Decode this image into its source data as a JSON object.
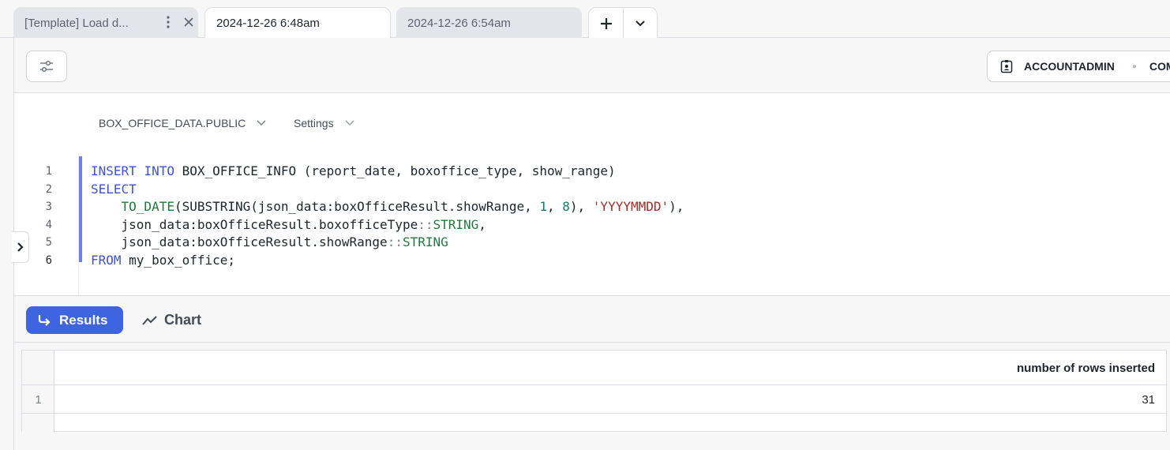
{
  "tabs": [
    {
      "label": "[Template] Load d...",
      "state": "inactive"
    },
    {
      "label": "2024-12-26 6:48am",
      "state": "active"
    },
    {
      "label": "2024-12-26 6:54am",
      "state": "inactive"
    }
  ],
  "toolbar": {
    "role": "ACCOUNTADMIN",
    "warehouse_partial": "COM"
  },
  "context": {
    "database": "BOX_OFFICE_DATA.PUBLIC",
    "settings": "Settings"
  },
  "editor": {
    "line_numbers": [
      "1",
      "2",
      "3",
      "4",
      "5",
      "6"
    ],
    "lines": [
      [
        {
          "t": "INSERT",
          "c": "kw"
        },
        {
          "t": " "
        },
        {
          "t": "INTO",
          "c": "kw"
        },
        {
          "t": " BOX_OFFICE_INFO (report_date, boxoffice_type, show_range)"
        }
      ],
      [
        {
          "t": "SELECT",
          "c": "kw"
        }
      ],
      [
        {
          "t": "    "
        },
        {
          "t": "TO_DATE",
          "c": "fn"
        },
        {
          "t": "(SUBSTRING(json_data:boxOfficeResult.showRange, "
        },
        {
          "t": "1",
          "c": "num"
        },
        {
          "t": ", "
        },
        {
          "t": "8",
          "c": "num"
        },
        {
          "t": "), "
        },
        {
          "t": "'YYYYMMDD'",
          "c": "str"
        },
        {
          "t": "),"
        }
      ],
      [
        {
          "t": "    json_data:boxOfficeResult.boxofficeType"
        },
        {
          "t": "::",
          "c": "op"
        },
        {
          "t": "STRING",
          "c": "typ"
        },
        {
          "t": ","
        }
      ],
      [
        {
          "t": "    json_data:boxOfficeResult.showRange"
        },
        {
          "t": "::",
          "c": "op"
        },
        {
          "t": "STRING",
          "c": "typ"
        }
      ],
      [
        {
          "t": "FROM",
          "c": "kw"
        },
        {
          "t": " my_box_office;"
        }
      ]
    ]
  },
  "results": {
    "results_label": "Results",
    "chart_label": "Chart",
    "column_header": "number of rows inserted",
    "rows": [
      {
        "num": "1",
        "value": "31"
      }
    ]
  },
  "colors": {
    "accent": "#3f64e0",
    "keyword": "#3d52d5",
    "selection_bar": "#6e7ff0"
  }
}
